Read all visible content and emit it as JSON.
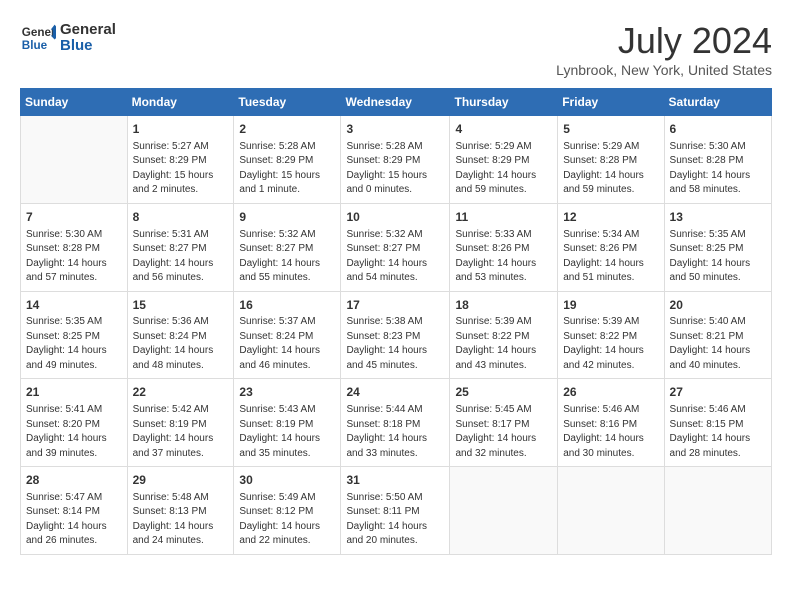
{
  "header": {
    "logo_line1": "General",
    "logo_line2": "Blue",
    "title": "July 2024",
    "subtitle": "Lynbrook, New York, United States"
  },
  "columns": [
    "Sunday",
    "Monday",
    "Tuesday",
    "Wednesday",
    "Thursday",
    "Friday",
    "Saturday"
  ],
  "weeks": [
    [
      {
        "day": "",
        "info": ""
      },
      {
        "day": "1",
        "info": "Sunrise: 5:27 AM\nSunset: 8:29 PM\nDaylight: 15 hours\nand 2 minutes."
      },
      {
        "day": "2",
        "info": "Sunrise: 5:28 AM\nSunset: 8:29 PM\nDaylight: 15 hours\nand 1 minute."
      },
      {
        "day": "3",
        "info": "Sunrise: 5:28 AM\nSunset: 8:29 PM\nDaylight: 15 hours\nand 0 minutes."
      },
      {
        "day": "4",
        "info": "Sunrise: 5:29 AM\nSunset: 8:29 PM\nDaylight: 14 hours\nand 59 minutes."
      },
      {
        "day": "5",
        "info": "Sunrise: 5:29 AM\nSunset: 8:28 PM\nDaylight: 14 hours\nand 59 minutes."
      },
      {
        "day": "6",
        "info": "Sunrise: 5:30 AM\nSunset: 8:28 PM\nDaylight: 14 hours\nand 58 minutes."
      }
    ],
    [
      {
        "day": "7",
        "info": "Sunrise: 5:30 AM\nSunset: 8:28 PM\nDaylight: 14 hours\nand 57 minutes."
      },
      {
        "day": "8",
        "info": "Sunrise: 5:31 AM\nSunset: 8:27 PM\nDaylight: 14 hours\nand 56 minutes."
      },
      {
        "day": "9",
        "info": "Sunrise: 5:32 AM\nSunset: 8:27 PM\nDaylight: 14 hours\nand 55 minutes."
      },
      {
        "day": "10",
        "info": "Sunrise: 5:32 AM\nSunset: 8:27 PM\nDaylight: 14 hours\nand 54 minutes."
      },
      {
        "day": "11",
        "info": "Sunrise: 5:33 AM\nSunset: 8:26 PM\nDaylight: 14 hours\nand 53 minutes."
      },
      {
        "day": "12",
        "info": "Sunrise: 5:34 AM\nSunset: 8:26 PM\nDaylight: 14 hours\nand 51 minutes."
      },
      {
        "day": "13",
        "info": "Sunrise: 5:35 AM\nSunset: 8:25 PM\nDaylight: 14 hours\nand 50 minutes."
      }
    ],
    [
      {
        "day": "14",
        "info": "Sunrise: 5:35 AM\nSunset: 8:25 PM\nDaylight: 14 hours\nand 49 minutes."
      },
      {
        "day": "15",
        "info": "Sunrise: 5:36 AM\nSunset: 8:24 PM\nDaylight: 14 hours\nand 48 minutes."
      },
      {
        "day": "16",
        "info": "Sunrise: 5:37 AM\nSunset: 8:24 PM\nDaylight: 14 hours\nand 46 minutes."
      },
      {
        "day": "17",
        "info": "Sunrise: 5:38 AM\nSunset: 8:23 PM\nDaylight: 14 hours\nand 45 minutes."
      },
      {
        "day": "18",
        "info": "Sunrise: 5:39 AM\nSunset: 8:22 PM\nDaylight: 14 hours\nand 43 minutes."
      },
      {
        "day": "19",
        "info": "Sunrise: 5:39 AM\nSunset: 8:22 PM\nDaylight: 14 hours\nand 42 minutes."
      },
      {
        "day": "20",
        "info": "Sunrise: 5:40 AM\nSunset: 8:21 PM\nDaylight: 14 hours\nand 40 minutes."
      }
    ],
    [
      {
        "day": "21",
        "info": "Sunrise: 5:41 AM\nSunset: 8:20 PM\nDaylight: 14 hours\nand 39 minutes."
      },
      {
        "day": "22",
        "info": "Sunrise: 5:42 AM\nSunset: 8:19 PM\nDaylight: 14 hours\nand 37 minutes."
      },
      {
        "day": "23",
        "info": "Sunrise: 5:43 AM\nSunset: 8:19 PM\nDaylight: 14 hours\nand 35 minutes."
      },
      {
        "day": "24",
        "info": "Sunrise: 5:44 AM\nSunset: 8:18 PM\nDaylight: 14 hours\nand 33 minutes."
      },
      {
        "day": "25",
        "info": "Sunrise: 5:45 AM\nSunset: 8:17 PM\nDaylight: 14 hours\nand 32 minutes."
      },
      {
        "day": "26",
        "info": "Sunrise: 5:46 AM\nSunset: 8:16 PM\nDaylight: 14 hours\nand 30 minutes."
      },
      {
        "day": "27",
        "info": "Sunrise: 5:46 AM\nSunset: 8:15 PM\nDaylight: 14 hours\nand 28 minutes."
      }
    ],
    [
      {
        "day": "28",
        "info": "Sunrise: 5:47 AM\nSunset: 8:14 PM\nDaylight: 14 hours\nand 26 minutes."
      },
      {
        "day": "29",
        "info": "Sunrise: 5:48 AM\nSunset: 8:13 PM\nDaylight: 14 hours\nand 24 minutes."
      },
      {
        "day": "30",
        "info": "Sunrise: 5:49 AM\nSunset: 8:12 PM\nDaylight: 14 hours\nand 22 minutes."
      },
      {
        "day": "31",
        "info": "Sunrise: 5:50 AM\nSunset: 8:11 PM\nDaylight: 14 hours\nand 20 minutes."
      },
      {
        "day": "",
        "info": ""
      },
      {
        "day": "",
        "info": ""
      },
      {
        "day": "",
        "info": ""
      }
    ]
  ]
}
